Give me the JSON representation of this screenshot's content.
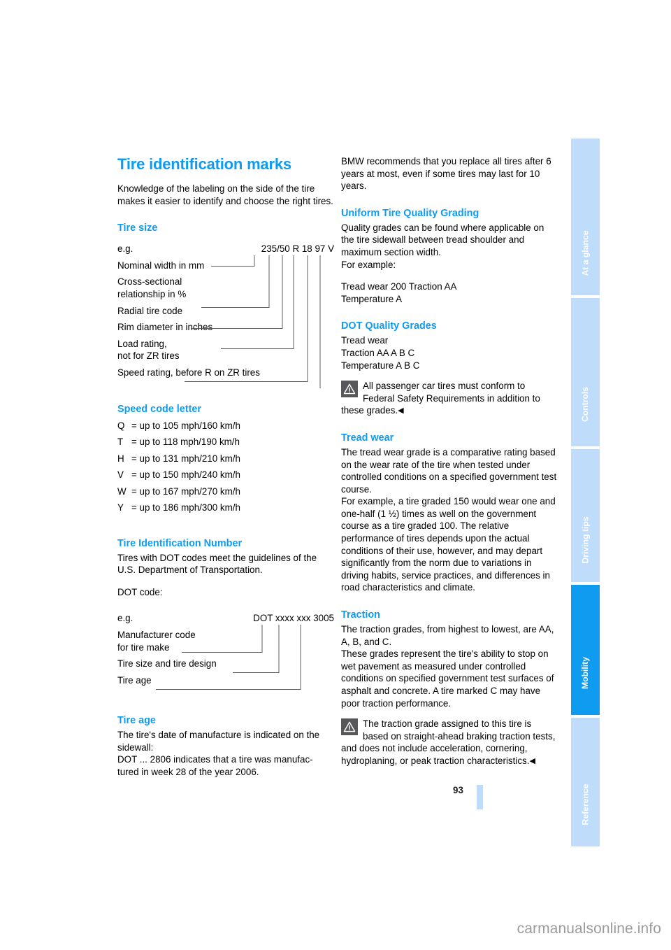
{
  "page": {
    "number": "93",
    "watermark": "carmanualsonline.info"
  },
  "left_column": {
    "title": "Tire identification marks",
    "intro": "Knowledge of the labeling on the side of the tire makes it easier to identify and choose the right tires.",
    "tire_size": {
      "heading": "Tire size",
      "eg_label": "e.g.",
      "eg_value": "235/50 R 18 97 V",
      "callouts": [
        "Nominal width in mm",
        "Cross-sectional",
        "relationship in %",
        "Radial tire code",
        "Rim diameter in inches",
        "Load rating,",
        "not for ZR tires",
        "Speed rating, before R on ZR tires"
      ]
    },
    "speed_code": {
      "heading": "Speed code letter",
      "rows": [
        {
          "letter": "Q",
          "definition": "= up to 105 mph/160 km/h"
        },
        {
          "letter": "T",
          "definition": "= up to 118 mph/190 km/h"
        },
        {
          "letter": "H",
          "definition": "= up to 131 mph/210 km/h"
        },
        {
          "letter": "V",
          "definition": "= up to 150 mph/240 km/h"
        },
        {
          "letter": "W",
          "definition": "= up to 167 mph/270 km/h"
        },
        {
          "letter": "Y",
          "definition": "= up to 186 mph/300 km/h"
        }
      ]
    },
    "tin": {
      "heading": "Tire Identification Number",
      "para1": "Tires with DOT codes meet the guidelines of the U.S. Department of Transportation.",
      "para2": "DOT code:",
      "eg_label": "e.g.",
      "eg_value": "DOT xxxx xxx 3005",
      "callouts": [
        "Manufacturer code",
        "for tire make",
        "Tire size and tire design",
        "Tire age"
      ]
    },
    "tire_age": {
      "heading": "Tire age",
      "para": "The tire's date of manufacture is indicated on the sidewall:\nDOT ... 2806 indicates that a tire was manufac-tured in week 28 of the year 2006."
    }
  },
  "right_column": {
    "intro": "BMW recommends that you replace all tires after 6 years at most, even if some tires may last for 10 years.",
    "utqg": {
      "heading": "Uniform Tire Quality Grading",
      "para1": "Quality grades can be found where applicable on the tire sidewall between tread shoulder and maximum section width.",
      "para2": "For example:",
      "para3": "Tread wear 200 Traction AA",
      "para4": "Temperature A"
    },
    "dot_quality": {
      "heading": "DOT Quality Grades",
      "line1": "Tread wear",
      "line2": "Traction AA A B C",
      "line3": "Temperature A B C",
      "note": "All passenger car tires must conform to Federal Safety Requirements in addition to these grades.",
      "note_end": "◀"
    },
    "tread_wear": {
      "heading": "Tread wear",
      "para1": "The tread wear grade is a comparative rating based on the wear rate of the tire when tested under controlled conditions on a specified government test course.",
      "para2": "For example, a tire graded 150 would wear one and one-half (1 ½) times as well on the government course as a tire graded 100. The relative performance of tires depends upon the actual conditions of their use, however, and may depart significantly from the norm due to variations in driving habits, service practices, and differences in road characteristics and climate."
    },
    "traction": {
      "heading": "Traction",
      "para1": "The traction grades, from highest to lowest, are AA, A, B, and C.",
      "para2": "These grades represent the tire's ability to stop on wet pavement as measured under controlled conditions on specified government test surfaces of asphalt and concrete. A tire marked C may have poor traction performance.",
      "note": "The traction grade assigned to this tire is based on straight-ahead braking traction tests, and does not include acceleration, cornering, hydroplaning, or peak traction characteristics.",
      "note_end": "◀"
    }
  },
  "tabs": [
    {
      "label": "At a glance",
      "active": false
    },
    {
      "label": "Controls",
      "active": false
    },
    {
      "label": "Driving tips",
      "active": false
    },
    {
      "label": "Mobility",
      "active": true
    },
    {
      "label": "Reference",
      "active": false
    }
  ],
  "colors": {
    "accent": "#0e9bf0",
    "accent_light": "#69b9ee",
    "tab_inactive": "#bfdcfa",
    "icon_bg": "#58585a",
    "watermark": "#9b9b9e"
  }
}
